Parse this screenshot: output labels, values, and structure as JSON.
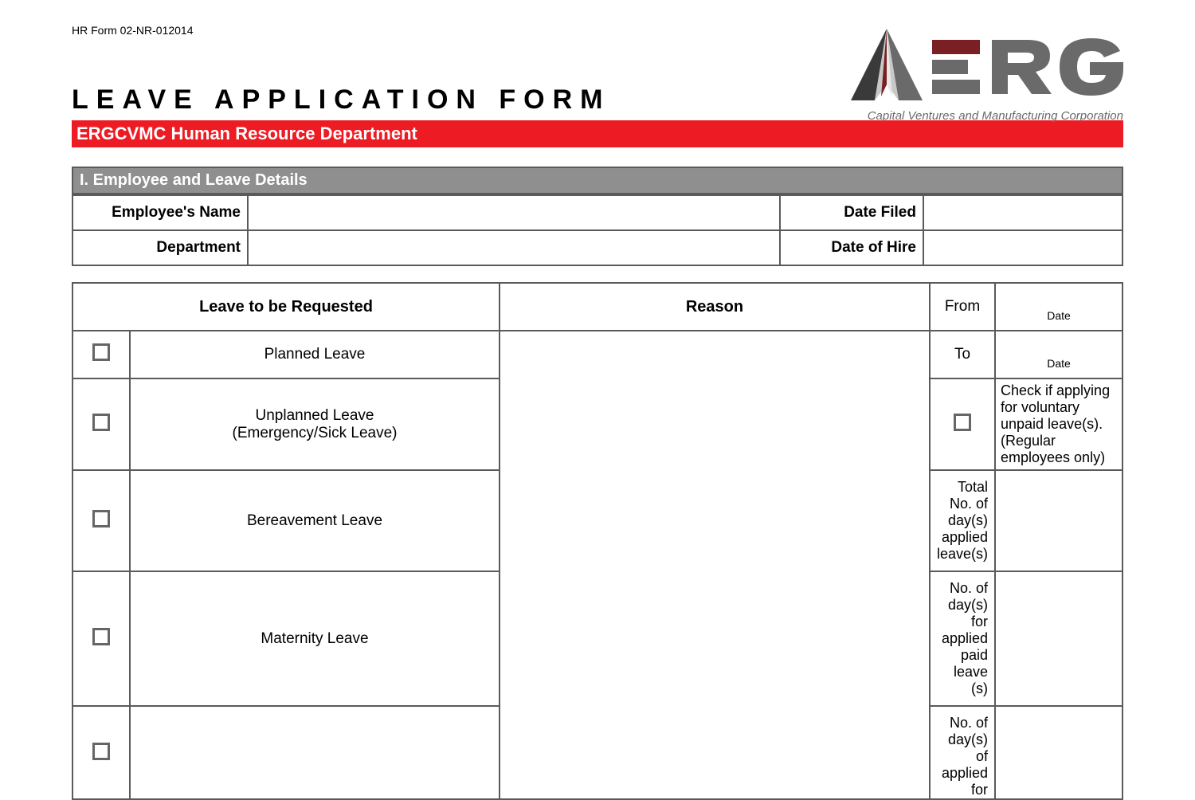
{
  "form_code": "HR Form 02-NR-012014",
  "title": "LEAVE  APPLICATION  FORM",
  "red_bar": "ERGCVMC Human Resource Department",
  "logo": {
    "brand": "ERG",
    "tagline": "Capital Ventures and Manufacturing Corporation"
  },
  "section1": {
    "header": "I. Employee and Leave Details",
    "rows": [
      {
        "label1": "Employee's Name",
        "label2": "Date Filed"
      },
      {
        "label1": "Department",
        "label2": "Date of Hire"
      }
    ]
  },
  "leave_table": {
    "headers": {
      "leave": "Leave to be Requested",
      "reason": "Reason",
      "from": "From",
      "to": "To",
      "date": "Date"
    },
    "options": [
      "Planned Leave",
      "Unplanned Leave",
      "(Emergency/Sick Leave)",
      "Bereavement Leave",
      "Maternity Leave"
    ],
    "voluntary_note": "Check if applying for voluntary unpaid leave(s). (Regular employees only)",
    "total_days": "Total No. of day(s) applied leave(s)",
    "paid_days": "No. of day(s) for applied paid leave (s)",
    "unpaid_days": "No. of day(s) of applied for"
  }
}
